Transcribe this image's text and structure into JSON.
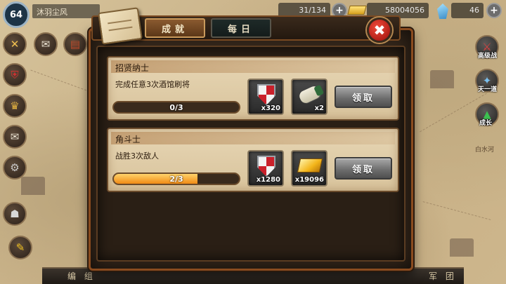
{
  "hud": {
    "level": "64",
    "player_name": "沐羽尘风",
    "troops": "31/134",
    "gold": "58004056",
    "gems": "46"
  },
  "side": {
    "right_labels": [
      "高级战",
      "天一道",
      "成长"
    ],
    "map_label": "白水河"
  },
  "bottom": {
    "left_label": "编 组",
    "right_label": "军 团"
  },
  "dialog": {
    "tabs": [
      {
        "label": "成就",
        "active": true
      },
      {
        "label": "每日",
        "active": false
      }
    ],
    "close_label": "✖",
    "tasks": [
      {
        "title": "招贤纳士",
        "description": "完成任意3次酒馆刷将",
        "progress_text": "0/3",
        "progress": 0.0,
        "rewards": [
          {
            "icon": "shield-icon",
            "count": "x320"
          },
          {
            "icon": "scroll-icon",
            "count": "x2"
          }
        ],
        "claim_label": "领取"
      },
      {
        "title": "角斗士",
        "description": "战胜3次敌人",
        "progress_text": "2/3",
        "progress": 0.667,
        "rewards": [
          {
            "icon": "shield-icon",
            "count": "x1280"
          },
          {
            "icon": "gold-bar-icon",
            "count": "x19096"
          }
        ],
        "claim_label": "领取"
      }
    ]
  }
}
